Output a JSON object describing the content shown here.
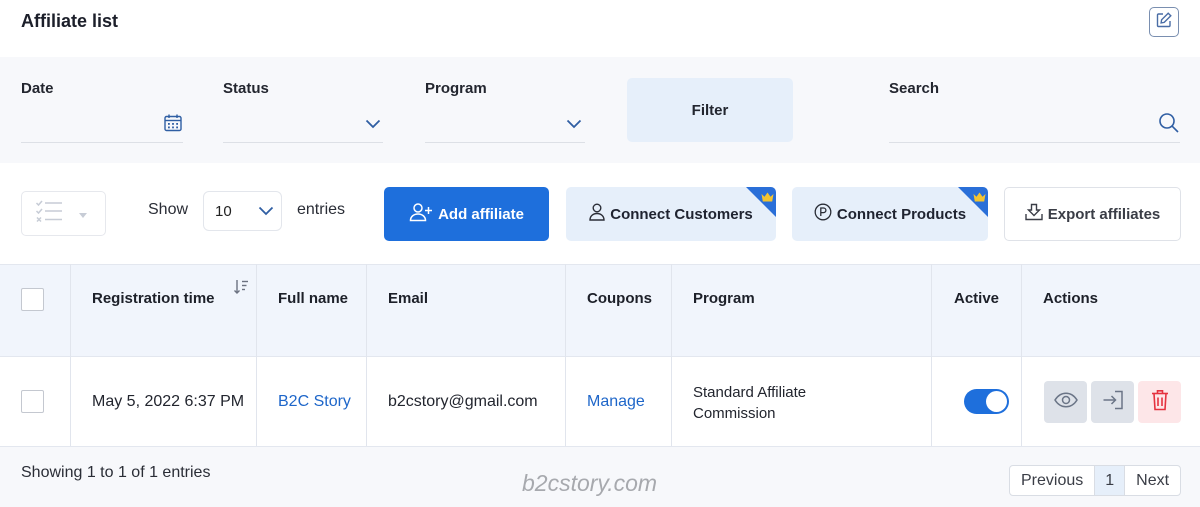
{
  "header": {
    "title": "Affiliate list",
    "edit_icon": "edit-icon"
  },
  "filters": {
    "date": {
      "label": "Date",
      "value": "",
      "icon": "calendar-icon"
    },
    "status": {
      "label": "Status",
      "value": ""
    },
    "program": {
      "label": "Program",
      "value": ""
    },
    "filter_button": "Filter",
    "search": {
      "label": "Search",
      "value": "",
      "icon": "search-icon"
    }
  },
  "toolbar": {
    "show_label": "Show",
    "entries_value": "10",
    "entries_label": "entries",
    "add_affiliate": "Add affiliate",
    "connect_customers": "Connect Customers",
    "connect_products": "Connect Products",
    "export_affiliates": "Export affiliates"
  },
  "table": {
    "columns": [
      "Registration time",
      "Full name",
      "Email",
      "Coupons",
      "Program",
      "Active",
      "Actions"
    ],
    "rows": [
      {
        "registration_time": "May 5, 2022 6:37 PM",
        "full_name": "B2C Story",
        "email": "b2cstory@gmail.com",
        "coupons": "Manage",
        "program_line1": "Standard Affiliate",
        "program_line2": "Commission",
        "active": true
      }
    ]
  },
  "footer": {
    "showing": "Showing 1 to 1 of 1 entries",
    "watermark": "b2cstory.com",
    "pagination": {
      "previous": "Previous",
      "current": "1",
      "next": "Next"
    }
  },
  "colors": {
    "primary": "#1e6fdc",
    "soft_blue": "#e6effa",
    "danger": "#e5323f",
    "link": "#1e66c9"
  }
}
